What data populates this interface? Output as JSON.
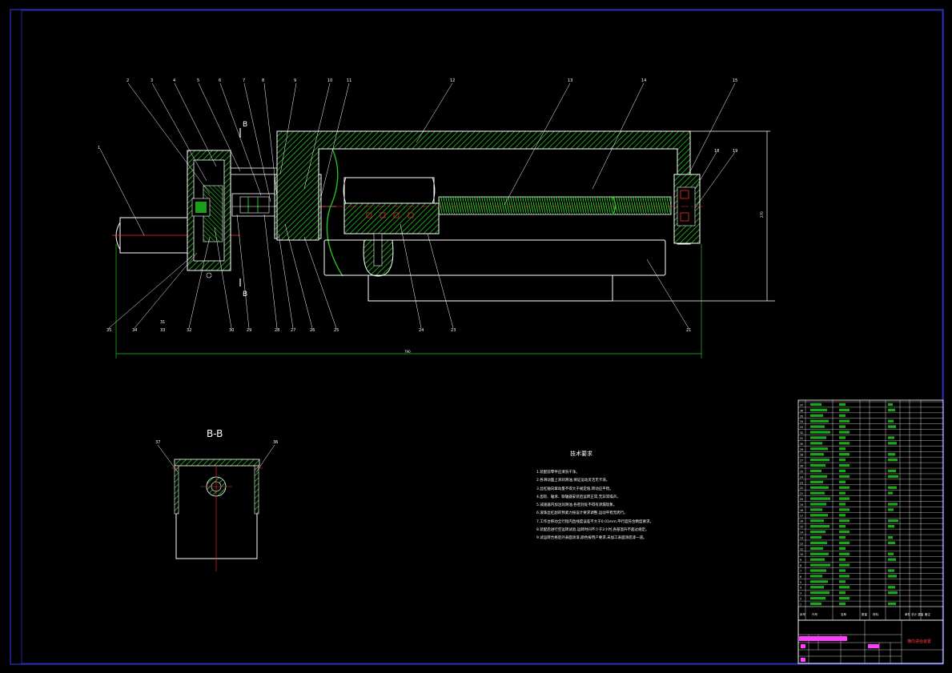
{
  "view_section_label": "B-B",
  "section_mark": "B",
  "notes": {
    "heading": "技术要求",
    "lines": [
      "1.装配前零件应清洗干净。",
      "2.各滑动面上涂润滑油,保证运动灵活无卡滞。",
      "3.丝杠轴向窜动量不得大于规定值,转动应平稳。",
      "4.齿轮、轴承、联轴器安装后运转正常,无异常噪声。",
      "5.减速器内加注润滑油,各密封处不得有渗漏现象。",
      "6.滚珠丝杠副的预紧力按设计要求调整,运动平稳无爬行。",
      "7.工作台移动全行程内直线度误差不大于0.01mm,平行度符合精度要求。",
      "8.装配后进行空运转试验,运转时间不少于2小时,各部温升不超过规定。",
      "9.试运转合格后外表面涂漆,颜色按用户要求,未加工表面涂底漆一道。"
    ]
  },
  "callouts_top": [
    "2",
    "3",
    "4",
    "5",
    "6",
    "7",
    "8",
    "9",
    "10",
    "11",
    "12",
    "13",
    "14",
    "15",
    "17"
  ],
  "callouts_bottom": [
    "35",
    "34",
    "33",
    "32",
    "30",
    "29",
    "28",
    "27",
    "26",
    "25",
    "24",
    "23",
    "22",
    "21"
  ],
  "callouts_other": [
    "1",
    "18",
    "19",
    "31",
    "36",
    "37"
  ],
  "dimensions": {
    "overall_length": "790",
    "height": "270"
  },
  "title_block": {
    "drawing_name": "横向进给装置",
    "part_numbers": [
      "37",
      "36",
      "35",
      "34",
      "33",
      "32",
      "31",
      "30",
      "29",
      "28",
      "27",
      "26",
      "25",
      "24",
      "23",
      "22",
      "21",
      "20",
      "19",
      "18",
      "17",
      "16",
      "15",
      "14",
      "13",
      "12",
      "11",
      "10",
      "9",
      "8",
      "7",
      "6",
      "5",
      "4",
      "3",
      "2",
      "1"
    ],
    "header": [
      "序号",
      "代号",
      "名称",
      "数量",
      "材料",
      "单件 总计 重量",
      "备注"
    ]
  },
  "colors": {
    "background": "#000000",
    "outline": "#ffffff",
    "hatch": "#22c322",
    "frame": "#3a3af0",
    "center_line": "#ff2a2a",
    "highlight": "#ff3cff"
  }
}
